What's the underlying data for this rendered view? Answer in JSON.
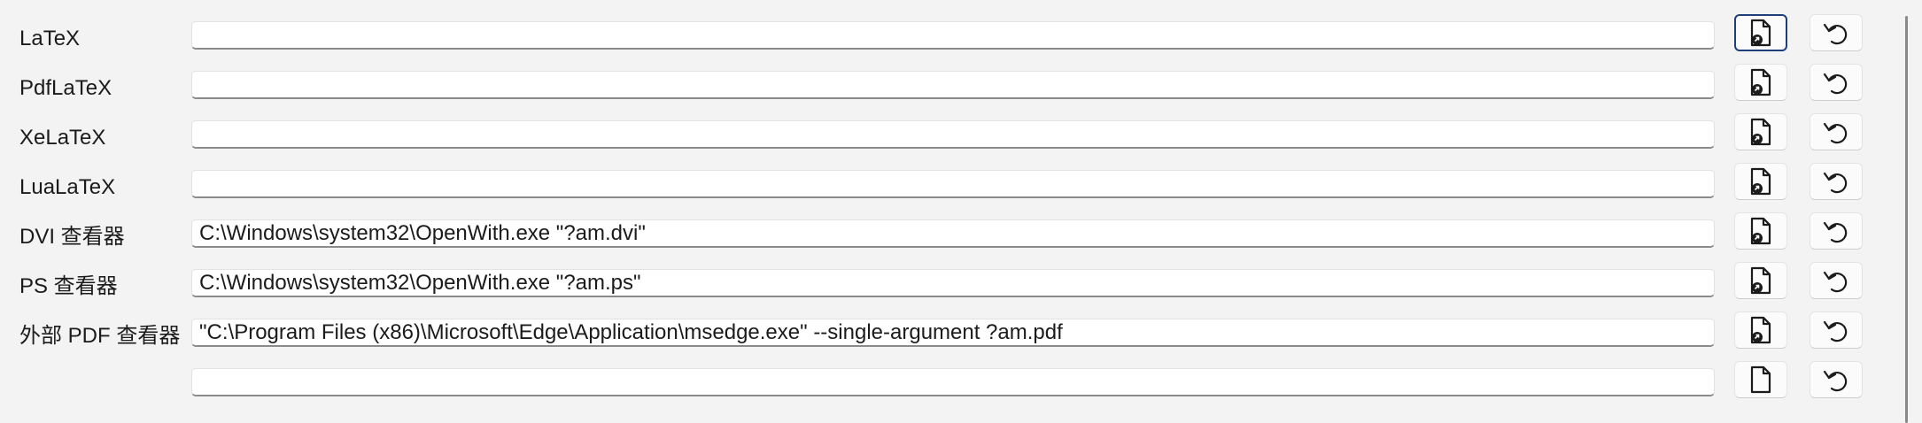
{
  "rows": [
    {
      "label": "LaTeX",
      "value": "",
      "placeholder": "",
      "browse_icon": "file-browse-icon",
      "reset_icon": "undo-icon"
    },
    {
      "label": "PdfLaTeX",
      "value": "",
      "placeholder": "",
      "browse_icon": "file-browse-icon",
      "reset_icon": "undo-icon"
    },
    {
      "label": "XeLaTeX",
      "value": "",
      "placeholder": "",
      "browse_icon": "file-browse-icon",
      "reset_icon": "undo-icon"
    },
    {
      "label": "LuaLaTeX",
      "value": "",
      "placeholder": "",
      "browse_icon": "file-browse-icon",
      "reset_icon": "undo-icon"
    },
    {
      "label": "DVI 查看器",
      "value": "C:\\Windows\\system32\\OpenWith.exe \"?am.dvi\"",
      "placeholder": "",
      "browse_icon": "file-browse-icon",
      "reset_icon": "undo-icon"
    },
    {
      "label": "PS 查看器",
      "value": "C:\\Windows\\system32\\OpenWith.exe \"?am.ps\"",
      "placeholder": "",
      "browse_icon": "file-browse-icon",
      "reset_icon": "undo-icon"
    },
    {
      "label": "外部 PDF 查看器",
      "value": "\"C:\\Program Files (x86)\\Microsoft\\Edge\\Application\\msedge.exe\" --single-argument ?am.pdf",
      "placeholder": "",
      "browse_icon": "file-browse-icon",
      "reset_icon": "undo-icon"
    },
    {
      "label": "",
      "value": "",
      "placeholder": "",
      "browse_icon": "file-browse-icon",
      "reset_icon": "undo-icon"
    }
  ],
  "colors": {
    "background": "#f3f3f3",
    "field_background": "#ffffff",
    "focus_border": "#1f3f7a",
    "text": "#1b1b1b"
  }
}
